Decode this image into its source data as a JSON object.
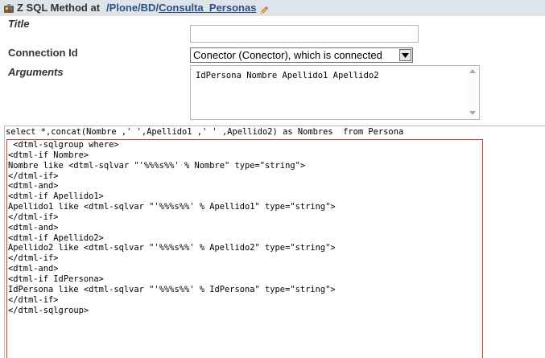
{
  "header": {
    "icon": "zsql-method-icon",
    "meta_type": "Z SQL Method at",
    "path_prefix": "/Plone/BD/",
    "current": "Consulta_Personas",
    "edit_icon": "pencil-icon"
  },
  "fields": {
    "title_label": "Title",
    "title_value": "",
    "connection_label": "Connection Id",
    "connection_value": "Conector (Conector), which is connected",
    "arguments_label": "Arguments",
    "arguments_value": "IdPersona Nombre Apellido1 Apellido2"
  },
  "editor": {
    "first_line": "select *,concat(Nombre ,' ',Apellido1 ,' ' ,Apellido2) as Nombres  from Persona",
    "lines": [
      " <dtml-sqlgroup where>",
      "<dtml-if Nombre>",
      "Nombre like <dtml-sqlvar \"'%%%s%%' % Nombre\" type=\"string\">",
      "</dtml-if>",
      "<dtml-and>",
      "<dtml-if Apellido1>",
      "Apellido1 like <dtml-sqlvar \"'%%%s%%' % Apellido1\" type=\"string\">",
      "</dtml-if>",
      "<dtml-and>",
      "<dtml-if Apellido2>",
      "Apellido2 like <dtml-sqlvar \"'%%%s%%' % Apellido2\" type=\"string\">",
      "</dtml-if>",
      "<dtml-and>",
      "<dtml-if IdPersona>",
      "IdPersona like <dtml-sqlvar \"'%%%s%%' % IdPersona\" type=\"string\">",
      "</dtml-if>",
      "</dtml-sqlgroup>"
    ]
  },
  "colors": {
    "header_bg": "#dde4ea",
    "link": "#2b4f86",
    "highlight_border": "#d13a3a"
  }
}
